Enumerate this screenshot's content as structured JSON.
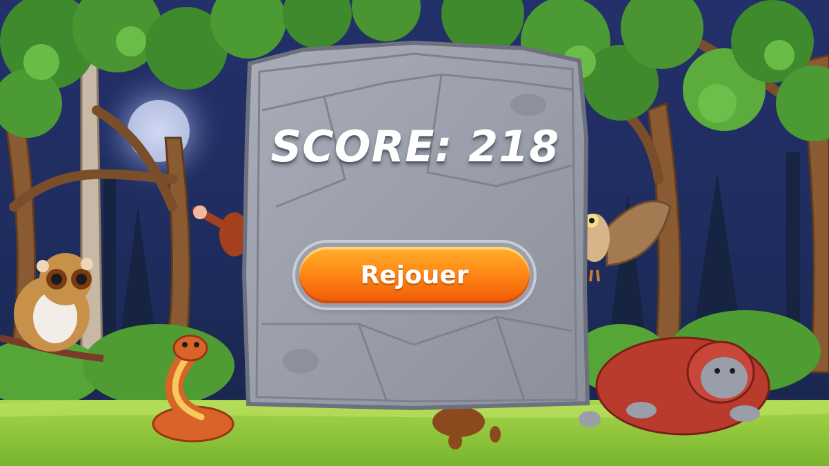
{
  "game": {
    "score_label": "SCORE:",
    "score_value": "218",
    "replay_label": "Rejouer"
  },
  "colors": {
    "night_sky": "#1c2a5a",
    "grass": "#8fc53c",
    "stone_panel": "#9a9eab",
    "button_orange": "#ff8a16"
  },
  "icons": [
    "slow-loris",
    "snake",
    "monkey",
    "owl",
    "orangutan",
    "tree",
    "bush",
    "moon"
  ]
}
